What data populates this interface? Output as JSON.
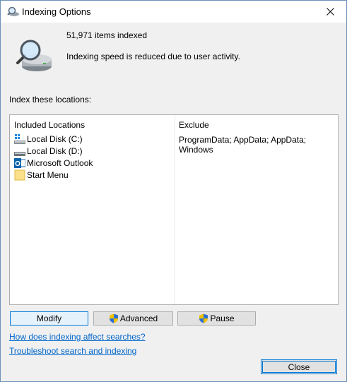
{
  "window": {
    "title": "Indexing Options"
  },
  "status": {
    "items_indexed": "51,971 items indexed",
    "speed_message": "Indexing speed is reduced due to user activity."
  },
  "locations_label": "Index these locations:",
  "table": {
    "col_included": "Included Locations",
    "col_exclude": "Exclude",
    "locations": [
      {
        "name": "Local Disk (C:)",
        "icon": "windows-drive-icon"
      },
      {
        "name": "Local Disk (D:)",
        "icon": "drive-icon"
      },
      {
        "name": "Microsoft Outlook",
        "icon": "outlook-icon"
      },
      {
        "name": "Start Menu",
        "icon": "folder-icon"
      }
    ],
    "exclude": "ProgramData; AppData; AppData; Windows"
  },
  "buttons": {
    "modify": "Modify",
    "advanced": "Advanced",
    "pause": "Pause",
    "close": "Close"
  },
  "links": {
    "how_affect": "How does indexing affect searches?",
    "troubleshoot": "Troubleshoot search and indexing"
  },
  "colors": {
    "link": "#0066cc",
    "focus": "#0078d7",
    "shield_blue": "#2a6fd6",
    "shield_yellow": "#f2c200"
  }
}
